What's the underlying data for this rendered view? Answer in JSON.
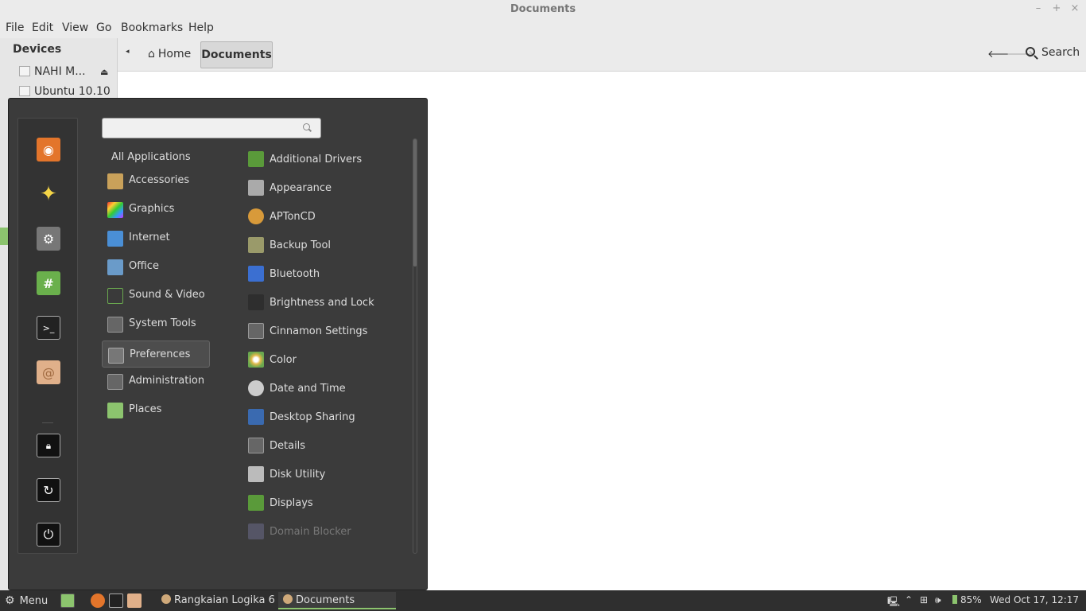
{
  "window": {
    "title": "Documents",
    "controls": [
      "–",
      "+",
      "×"
    ]
  },
  "menubar": [
    "File",
    "Edit",
    "View",
    "Go",
    "Bookmarks",
    "Help"
  ],
  "sidebar": {
    "section": "Devices",
    "devices": [
      {
        "label": "NAHI M...",
        "eject": "⏏"
      },
      {
        "label": "Ubuntu 10.10"
      }
    ]
  },
  "toolbar": {
    "back": "◂",
    "breadcrumbs": [
      "Home",
      "Documents"
    ],
    "nav_prev": "🡐",
    "nav_next": "🡒",
    "search": "Search"
  },
  "app_menu": {
    "search_value": "",
    "all_applications": "All Applications",
    "categories": [
      {
        "label": "Accessories",
        "color": "#c9a15a"
      },
      {
        "label": "Graphics",
        "color": "#d44"
      },
      {
        "label": "Internet",
        "color": "#4a8fd6"
      },
      {
        "label": "Office",
        "color": "#6a9bc9"
      },
      {
        "label": "Sound & Video",
        "color": "#6aa84f"
      },
      {
        "label": "System Tools",
        "color": "#888"
      },
      {
        "label": "Preferences",
        "color": "#999"
      },
      {
        "label": "Administration",
        "color": "#888"
      },
      {
        "label": "Places",
        "color": "#8cc46e"
      }
    ],
    "active_category": "Preferences",
    "applications": [
      {
        "label": "Additional Drivers",
        "color": "#5a9a3a"
      },
      {
        "label": "Appearance",
        "color": "#aaa"
      },
      {
        "label": "APTonCD",
        "color": "#d89a3a"
      },
      {
        "label": "Backup Tool",
        "color": "#9a9a6a"
      },
      {
        "label": "Bluetooth",
        "color": "#3b6fd1"
      },
      {
        "label": "Brightness and Lock",
        "color": "#2e2e2e"
      },
      {
        "label": "Cinnamon Settings",
        "color": "#888"
      },
      {
        "label": "Color",
        "color": "#e0b84a"
      },
      {
        "label": "Date and Time",
        "color": "#ccc"
      },
      {
        "label": "Desktop Sharing",
        "color": "#3a6ab0"
      },
      {
        "label": "Details",
        "color": "#888"
      },
      {
        "label": "Disk Utility",
        "color": "#bbb"
      },
      {
        "label": "Displays",
        "color": "#5a9a3a"
      },
      {
        "label": "Domain Blocker",
        "color": "#556"
      }
    ],
    "favorites": [
      {
        "icon": "firefox-icon",
        "color": "#e3752b"
      },
      {
        "icon": "star-icon",
        "color": "#f5d547"
      },
      {
        "icon": "system-settings-icon",
        "color": "#888"
      },
      {
        "icon": "chat-icon",
        "color": "#6ab04c"
      },
      {
        "icon": "terminal-icon",
        "color": "#222"
      },
      {
        "icon": "shell-icon",
        "color": "#e0b08a"
      },
      {
        "icon": "lock-icon",
        "color": "#111"
      },
      {
        "icon": "logout-icon",
        "color": "#111"
      },
      {
        "icon": "power-icon",
        "color": "#111"
      }
    ]
  },
  "taskbar": {
    "menu_label": "Menu",
    "tasks": [
      {
        "label": "Rangkaian Logika 6"
      },
      {
        "label": "Documents"
      }
    ],
    "battery": "85%",
    "clock": "Wed Oct 17, 12:17"
  }
}
